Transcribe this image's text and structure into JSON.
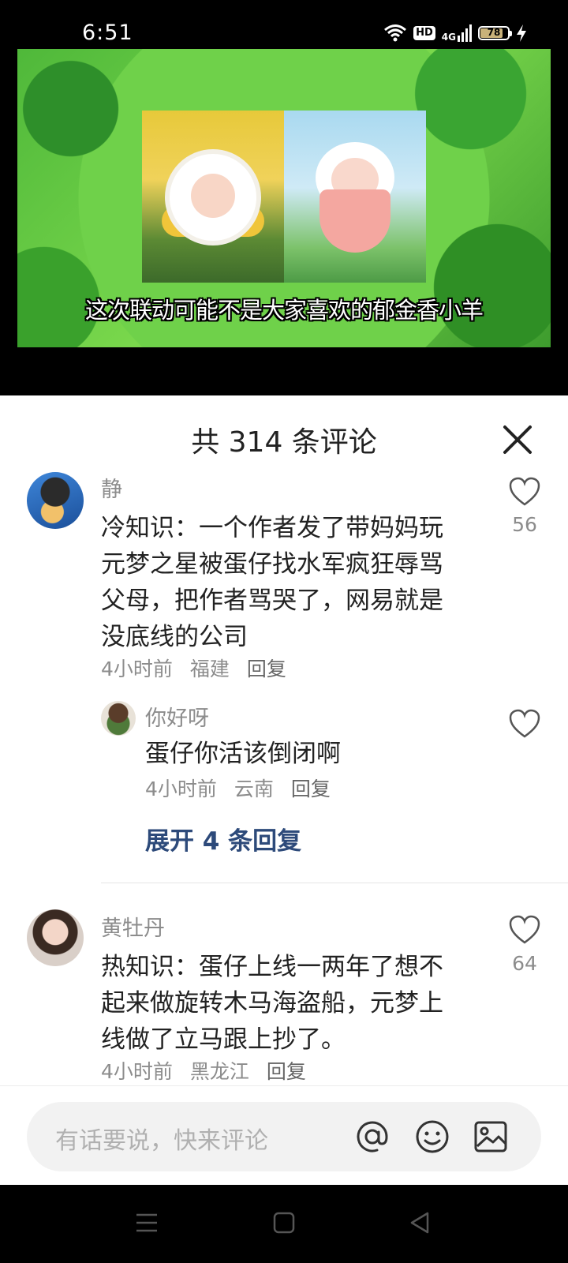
{
  "status_bar": {
    "time": "6:51",
    "icons": [
      "wifi-icon",
      "hd-icon",
      "signal-4g-icon",
      "battery-icon",
      "charging-icon"
    ],
    "hd_label": "HD",
    "network_label": "4G",
    "battery_level": "78"
  },
  "video": {
    "subtitle": "这次联动可能不是大家喜欢的郁金香小羊"
  },
  "comments_panel": {
    "title": "共 314 条评论",
    "comments": [
      {
        "user": "静",
        "text": "冷知识：一个作者发了带妈妈玩元梦之星被蛋仔找水军疯狂辱骂父母，把作者骂哭了，网易就是没底线的公司",
        "time": "4小时前",
        "location": "福建",
        "reply_label": "回复",
        "likes": "56",
        "replies": [
          {
            "user": "你好呀",
            "text": "蛋仔你活该倒闭啊",
            "time": "4小时前",
            "location": "云南",
            "reply_label": "回复"
          }
        ],
        "expand_label": "展开 4 条回复"
      },
      {
        "user": "黄牡丹",
        "text": "热知识：蛋仔上线一两年了想不起来做旋转木马海盗船，元梦上线做了立马跟上抄了。",
        "time": "4小时前",
        "location": "黑龙江",
        "reply_label": "回复",
        "likes": "64"
      }
    ]
  },
  "input_bar": {
    "placeholder": "有话要说，快来评论",
    "icons": [
      "at-icon",
      "emoji-icon",
      "image-icon"
    ]
  },
  "nav_bar": {
    "icons": [
      "menu-icon",
      "home-icon",
      "back-icon"
    ]
  }
}
